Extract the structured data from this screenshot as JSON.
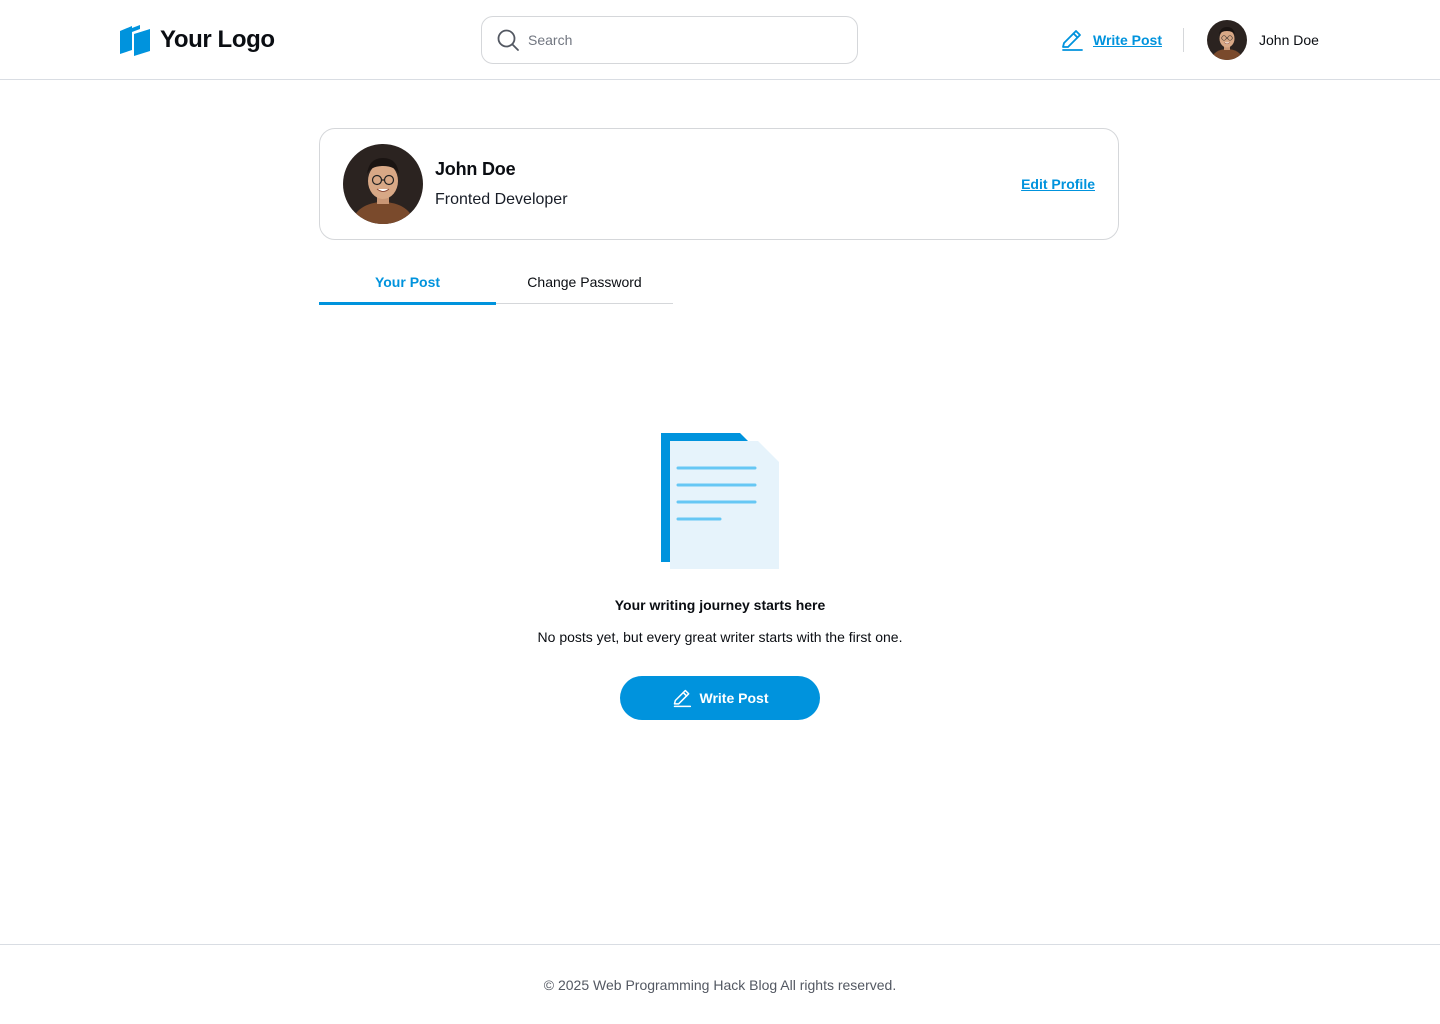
{
  "header": {
    "logo_text": "Your Logo",
    "search_placeholder": "Search",
    "write_post_label": "Write Post",
    "user_name": "John Doe"
  },
  "profile": {
    "name": "John Doe",
    "role": "Fronted Developer",
    "edit_label": "Edit Profile"
  },
  "tabs": [
    {
      "label": "Your Post",
      "active": true
    },
    {
      "label": "Change Password",
      "active": false
    }
  ],
  "empty_state": {
    "title": "Your writing journey starts here",
    "subtitle": "No posts yet, but every great writer starts with the first one.",
    "button_label": "Write Post"
  },
  "footer": {
    "text": "© 2025 Web Programming Hack Blog All rights reserved."
  },
  "colors": {
    "accent": "#0093dd",
    "border": "#d5d7da",
    "text": "#0a0d12",
    "muted": "#535862"
  },
  "icons": [
    "logo-mark-icon",
    "search-icon",
    "pen-icon",
    "document-illustration"
  ]
}
